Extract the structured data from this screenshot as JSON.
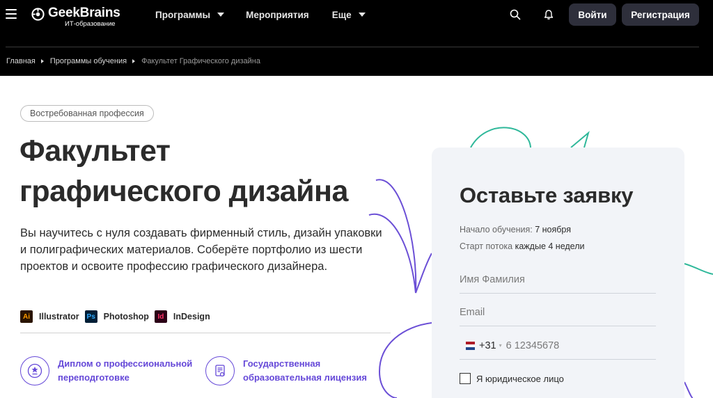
{
  "header": {
    "logo_name": "GeekBrains",
    "logo_sub": "ИТ-образование",
    "nav": [
      {
        "label": "Программы"
      },
      {
        "label": "Мероприятия"
      },
      {
        "label": "Еще"
      }
    ],
    "login_label": "Войти",
    "register_label": "Регистрация"
  },
  "breadcrumb": [
    "Главная",
    "Программы обучения",
    "Факультет Графического дизайна"
  ],
  "hero": {
    "badge": "Востребованная профессия",
    "title_line1": "Факультет",
    "title_line2": "графического дизайна",
    "description": "Вы научитесь с нуля создавать фирменный стиль, дизайн упаковки и полиграфических материалов. Соберёте портфолио из шести проектов и освоите профессию графического дизайнера.",
    "tools": [
      {
        "abbr": "Ai",
        "label": "Illustrator"
      },
      {
        "abbr": "Ps",
        "label": "Photoshop"
      },
      {
        "abbr": "Id",
        "label": "InDesign"
      }
    ],
    "features": [
      {
        "label": "Диплом о профессиональной переподготовке"
      },
      {
        "label": "Государственная образовательная лицензия"
      }
    ]
  },
  "form": {
    "title": "Оставьте заявку",
    "start_label": "Начало обучения:",
    "start_value": "7 ноября",
    "stream_label": "Старт потока",
    "stream_value": "каждые 4 недели",
    "name_placeholder": "Имя Фамилия",
    "email_placeholder": "Email",
    "country_code": "+31",
    "phone_placeholder": "6 12345678",
    "legal_entity_label": "Я юридическое лицо"
  },
  "colors": {
    "accent": "#6548d8",
    "teal": "#2fb89a",
    "purple": "#6b4fd6"
  }
}
